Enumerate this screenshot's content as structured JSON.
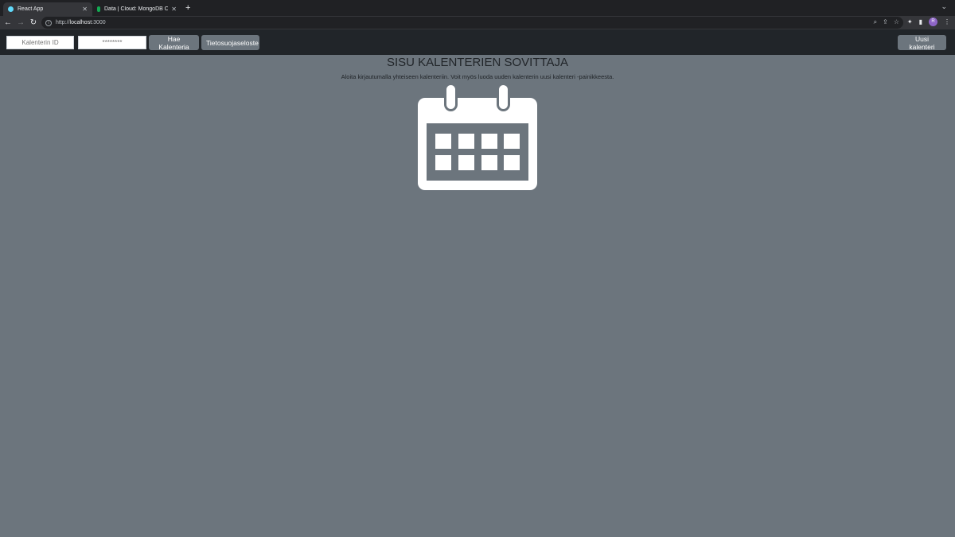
{
  "browser": {
    "tabs": [
      {
        "title": "React App",
        "active": true,
        "favicon_color": "#61dafb"
      },
      {
        "title": "Data | Cloud: MongoDB Cloud",
        "active": false,
        "favicon_color": "#13aa52"
      }
    ],
    "url_prefix": "http://",
    "url_host": "localhost",
    "url_suffix": ":3000",
    "profile_initial": "R"
  },
  "navbar": {
    "calendar_id_placeholder": "Kalenterin ID",
    "password_placeholder": "********",
    "fetch_button": "Hae Kalenteria",
    "privacy_button": "Tietosuojaseloste",
    "new_calendar_button": "Uusi kalenteri"
  },
  "main": {
    "title": "SISU KALENTERIEN SOVITTAJA",
    "description": "Aloita kirjautumalla yhteiseen kalenteriin. Voit myös luoda uuden kalenterin uusi kalenteri -painikkeesta.",
    "icon": "calendar-icon"
  },
  "colors": {
    "page_background": "#6c757d",
    "navbar_background": "#212529",
    "button_background": "#6c757d",
    "icon_color": "#ffffff"
  }
}
